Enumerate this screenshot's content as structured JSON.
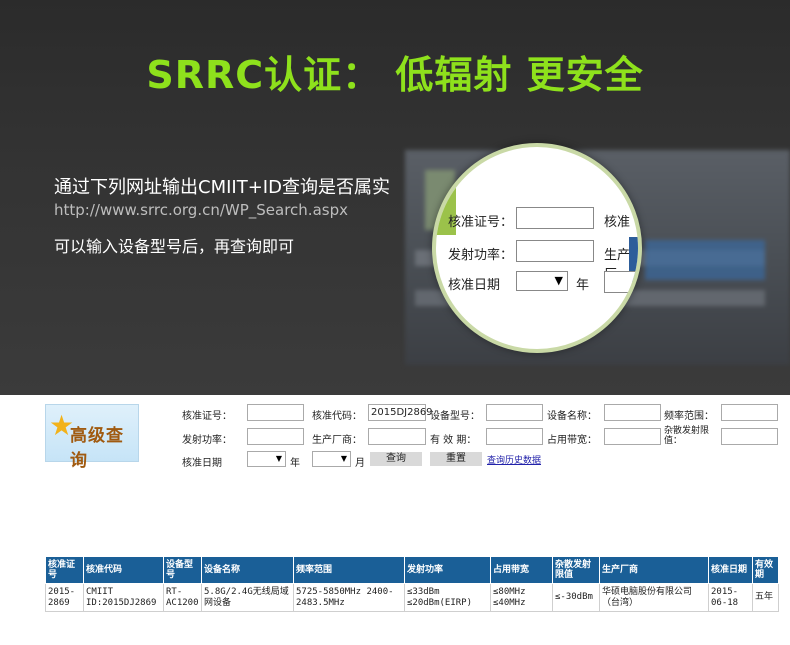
{
  "banner": {
    "title": "SRRC认证： 低辐射 更安全",
    "line1": "通过下列网址输出CMIIT+ID查询是否属实",
    "url": "http://www.srrc.org.cn/WP_Search.aspx",
    "line3": "可以输入设备型号后，再查询即可"
  },
  "magnifier": {
    "row1_label": "核准证号：",
    "row1_right": "核准",
    "row2_label": "发射功率：",
    "row2_right": "生产厂",
    "row3_label": "核准日期",
    "row3_suffix": "年",
    "select_arrow": "▼"
  },
  "logo": {
    "text": "高级查询",
    "star": "★"
  },
  "form": {
    "cert_no_label": "核准证号：",
    "cert_code_label": "核准代码：",
    "cert_code_value": "2015DJ2869",
    "model_label": "设备型号：",
    "device_name_label": "设备名称：",
    "freq_range_label": "频率范围：",
    "power_label": "发射功率：",
    "maker_label": "生产厂商：",
    "valid_label": "有 效 期：",
    "bandwidth_label": "占用带宽：",
    "spurious_label": "杂散发射限值：",
    "date_label": "核准日期",
    "year_label": "年",
    "month_label": "月",
    "select_arrow": "▼",
    "search_button": "查询",
    "reset_button": "重置",
    "history_link": "查询历史数据"
  },
  "table": {
    "headers": [
      "核准证号",
      "核准代码",
      "设备型号",
      "设备名称",
      "频率范围",
      "发射功率",
      "占用带宽",
      "杂散发射限值",
      "生产厂商",
      "核准日期",
      "有效期"
    ],
    "rows": [
      {
        "cert_no": "2015-2869",
        "cert_code": "CMIIT ID:2015DJ2869",
        "model": "RT-AC1200",
        "device_name": "5.8G/2.4G无线局域网设备",
        "freq_range": "5725-5850MHz 2400-2483.5MHz",
        "power_1": "≤33dBm",
        "power_2": "≤20dBm(EIRP)",
        "bandwidth_1": "≤80MHz",
        "bandwidth_2": "≤40MHz",
        "spurious": "≤-30dBm",
        "maker": "华硕电脑股份有限公司（台湾）",
        "date": "2015-06-18",
        "validity": "五年"
      }
    ]
  },
  "colors": {
    "title_green": "#8ee11c",
    "header_blue": "#1a5f97",
    "link_blue": "#2222aa"
  }
}
